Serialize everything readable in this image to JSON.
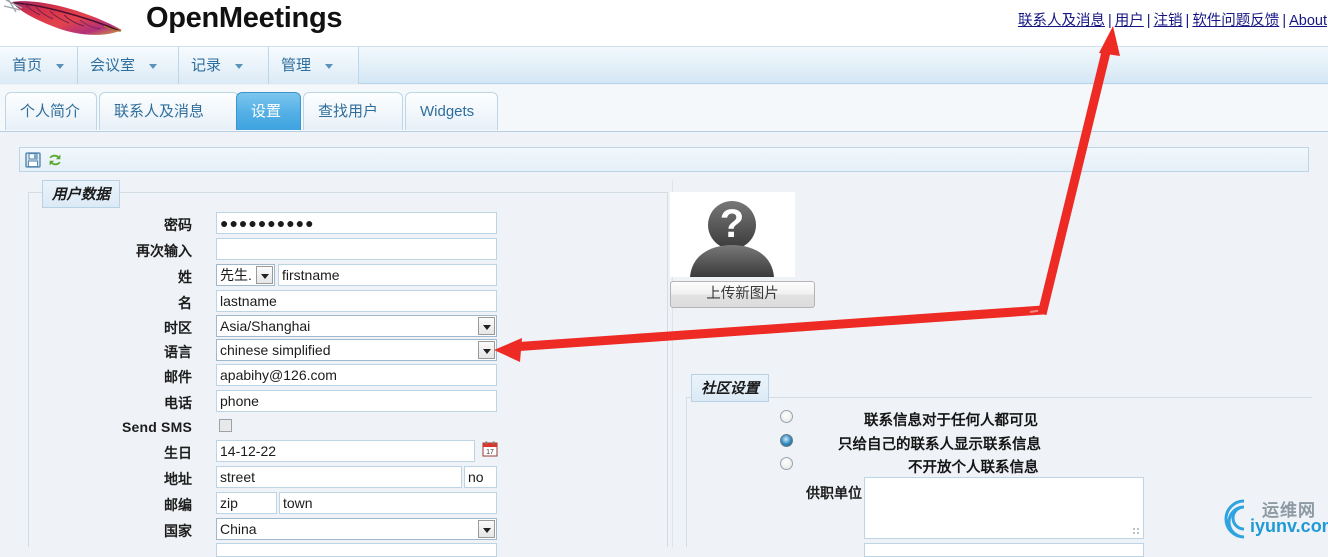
{
  "header": {
    "brand": "OpenMeetings",
    "logo_icon": "apache-feather-logo",
    "top_links": [
      {
        "label": "联系人及消息",
        "name": "contacts-and-messages-link"
      },
      {
        "label": "用户",
        "name": "user-link"
      },
      {
        "label": "注销",
        "name": "logout-link"
      },
      {
        "label": "软件问题反馈",
        "name": "software-feedback-link"
      },
      {
        "label": "About",
        "name": "about-link"
      }
    ],
    "separator": "|"
  },
  "menubar": {
    "items": [
      {
        "label": "首页",
        "caret": "chevron-down-icon"
      },
      {
        "label": "会议室",
        "caret": "chevron-down-icon"
      },
      {
        "label": "记录",
        "caret": "chevron-down-icon"
      },
      {
        "label": "管理",
        "caret": "chevron-down-icon"
      }
    ]
  },
  "tabs": [
    {
      "label": "个人简介",
      "active": false
    },
    {
      "label": "联系人及消息",
      "active": false
    },
    {
      "label": "设置",
      "active": true
    },
    {
      "label": "查找用户",
      "active": false
    },
    {
      "label": "Widgets",
      "active": false
    }
  ],
  "toolbar": {
    "save_icon": "save-disk-icon",
    "refresh_icon": "refresh-icon"
  },
  "user_data_panel": {
    "legend": "用户数据",
    "fields": {
      "password_label": "密码",
      "password_value": "●●●●●●●●●●",
      "password_retype_label": "再次输入",
      "password_retype_value": "",
      "firstname_label": "姓",
      "salutation_value": "先生.",
      "firstname_value": "firstname",
      "lastname_label": "名",
      "lastname_value": "lastname",
      "timezone_label": "时区",
      "timezone_value": "Asia/Shanghai",
      "language_label": "语言",
      "language_value": "chinese simplified",
      "email_label": "邮件",
      "email_value": "apabihy@126.com",
      "phone_label": "电话",
      "phone_value": "phone",
      "sendsms_label": "Send SMS",
      "sendsms_checked": false,
      "birthday_label": "生日",
      "birthday_value": "14-12-22",
      "calendar_icon": "calendar-picker-icon",
      "address_label": "地址",
      "street_value": "street",
      "streetno_value": "no",
      "zip_label": "邮编",
      "zip_value": "zip",
      "town_value": "town",
      "country_label": "国家",
      "country_value": "China"
    }
  },
  "avatar": {
    "icon": "question-mark-person-avatar",
    "upload_button": "上传新图片"
  },
  "community_panel": {
    "legend": "社区设置",
    "options": [
      {
        "label": "联系信息对于任何人都可见",
        "selected": false
      },
      {
        "label": "只给自己的联系人显示联系信息",
        "selected": true
      },
      {
        "label": "不开放个人联系信息",
        "selected": false
      }
    ],
    "organisation_label": "供职单位",
    "organisation_value": ""
  },
  "annotations": {
    "arrow_to_language": "red-arrow-pointing-to-language-dropdown",
    "arrow_to_user_link": "red-arrow-pointing-to-user-link",
    "color": "#ee2a24"
  },
  "watermark": {
    "text_cn": "运维网",
    "text_en": "iyunv.com",
    "icon": "swirl-circle-logo"
  }
}
